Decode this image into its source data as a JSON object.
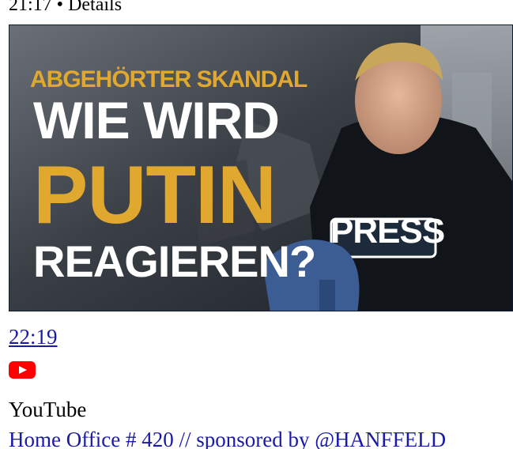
{
  "header": {
    "meta": "21:17 • Details"
  },
  "video": {
    "thumbnail": {
      "caption_top": "ABGEHÖRTER SKANDAL",
      "caption_line1": "WIE WIRD",
      "caption_line2": "PUTIN",
      "caption_line3": "REAGIEREN?",
      "vest_text": "PRESS"
    },
    "duration": "22:19",
    "source_icon": "youtube-icon",
    "source": "YouTube",
    "title": "Home Office # 420 // sponsored by @HANFFELD"
  },
  "colors": {
    "link": "#1a1aa8",
    "caption_yellow": "#e0a82e",
    "youtube_red": "#ff0000"
  }
}
